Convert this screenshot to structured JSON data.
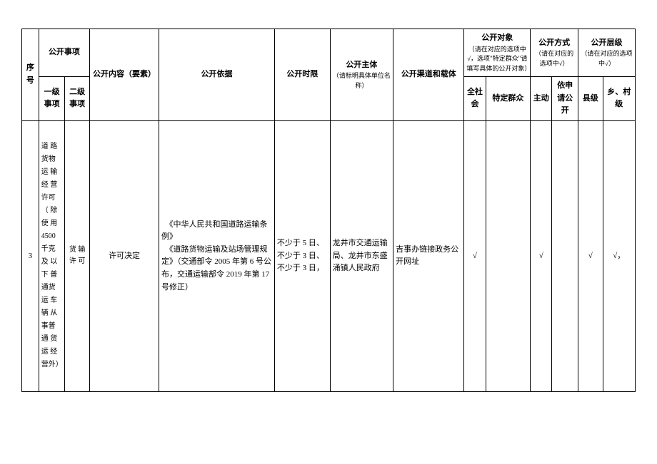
{
  "headers": {
    "seq": "序号",
    "matter": "公开事项",
    "level1": "一级事项",
    "level2": "二级事项",
    "content": "公开内容（要素）",
    "basis": "公开依据",
    "timelimit": "公开时限",
    "subject": "公开主体",
    "subject_note": "（请标明具体单位名称）",
    "channel": "公开渠道和载体",
    "target": "公开对象",
    "target_note": "（请在对应的选项中√，选项\"特定群众\"请填写具体的公开对象）",
    "all_society": "全社会",
    "specific": "特定群众",
    "method": "公开方式",
    "method_note": "（请在对应的选项中√）",
    "active": "主动",
    "on_apply": "依申请公开",
    "level": "公开层级",
    "level_note": "（请在对应的选项中√）",
    "county": "县级",
    "village": "乡、村级"
  },
  "row": {
    "seq": "3",
    "l1": "道 路 货物 运 输经 营 许可（ 除使 用 4500 千克 及 以下 普 通货 运 车辆 从 事普 通 货运 经 营外）",
    "l2": "货 输 许 可",
    "content": "许可决定",
    "basis": "　《中华人民共和国道路运输条例》\n　《道路货物运输及站场管理规定》（交通部令 2005 年第 6 号公布，交通运输部令 2019 年第 17 号修正）",
    "timelimit": "不少于 5 日、不少于 3 日、不少于 3 日，",
    "subject": "龙井市交通运输局、龙井市东盛涌镇人民政府",
    "channel": "吉事办链接政务公开网址",
    "all_society": "√",
    "specific": "",
    "active": "√",
    "on_apply": "",
    "county": "√",
    "village": "√，"
  }
}
